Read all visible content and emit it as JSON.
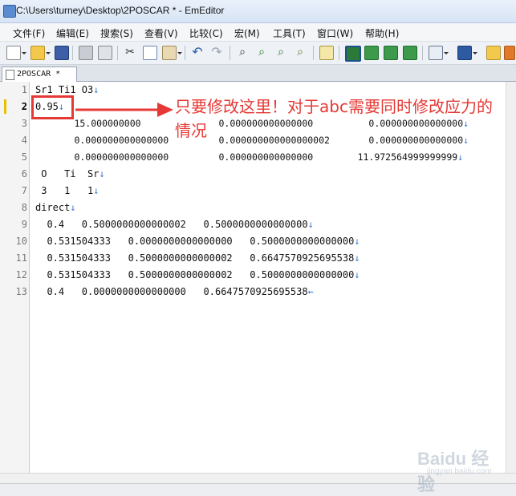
{
  "window": {
    "title": "C:\\Users\\turney\\Desktop\\2POSCAR * - EmEditor"
  },
  "menu": [
    "文件(F)",
    "编辑(E)",
    "搜索(S)",
    "查看(V)",
    "比较(C)",
    "宏(M)",
    "工具(T)",
    "窗口(W)",
    "帮助(H)"
  ],
  "tab": {
    "label": "2POSCAR *"
  },
  "editor": {
    "current_line": 2,
    "lines": [
      {
        "num": "1",
        "text": "Sr1 Ti1 O3",
        "eol": "↓"
      },
      {
        "num": "2",
        "text": "0.95",
        "eol": "↓"
      },
      {
        "num": "3",
        "text": "       15.000000000              0.000000000000000          0.000000000000000",
        "eol": "↓"
      },
      {
        "num": "4",
        "text": "       0.000000000000000         0.000000000000000002       0.000000000000000",
        "eol": "↓"
      },
      {
        "num": "5",
        "text": "       0.000000000000000         0.000000000000000        11.972564999999999",
        "eol": "↓"
      },
      {
        "num": "6",
        "text": " O   Ti  Sr",
        "eol": "↓"
      },
      {
        "num": "7",
        "text": " 3   1   1",
        "eol": "↓"
      },
      {
        "num": "8",
        "text": "direct",
        "eol": "↓"
      },
      {
        "num": "9",
        "text": "  0.4   0.5000000000000002   0.5000000000000000",
        "eol": "↓"
      },
      {
        "num": "10",
        "text": "  0.531504333   0.0000000000000000   0.5000000000000000",
        "eol": "↓"
      },
      {
        "num": "11",
        "text": "  0.531504333   0.5000000000000002   0.6647570925695538",
        "eol": "↓"
      },
      {
        "num": "12",
        "text": "  0.531504333   0.5000000000000002   0.5000000000000000",
        "eol": "↓"
      },
      {
        "num": "13",
        "text": "  0.4   0.0000000000000000   0.6647570925695538",
        "eol": "←"
      }
    ]
  },
  "annotation": {
    "text": "只要修改这里！对于abc需要同时修改应力的情况",
    "color": "#e53935"
  },
  "watermark": {
    "text": "Baidu 经验",
    "sub": "jingyan.baidu.com"
  },
  "colors": {
    "eol_marker": "#3a7bd5",
    "current_line_marker": "#e8c000"
  }
}
